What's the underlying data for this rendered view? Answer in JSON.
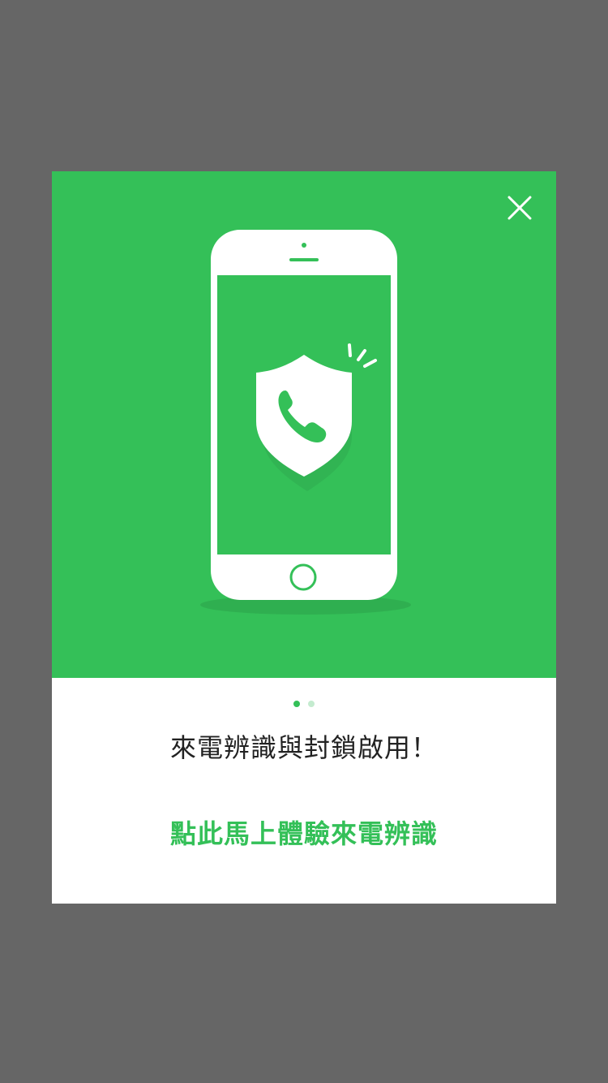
{
  "dialog": {
    "title": "來電辨識與封鎖啟用！",
    "cta_label": "點此馬上體驗來電辨識"
  },
  "pager": {
    "count": 2,
    "active_index": 0
  },
  "icons": {
    "close": "close-icon",
    "phone": "smartphone-icon",
    "shield": "shield-icon",
    "handset": "phone-handset-icon"
  },
  "colors": {
    "overlay": "#666666",
    "brand_green": "#34c058",
    "dot_inactive": "#c4ebcf",
    "text_dark": "#222222",
    "surface": "#ffffff"
  }
}
